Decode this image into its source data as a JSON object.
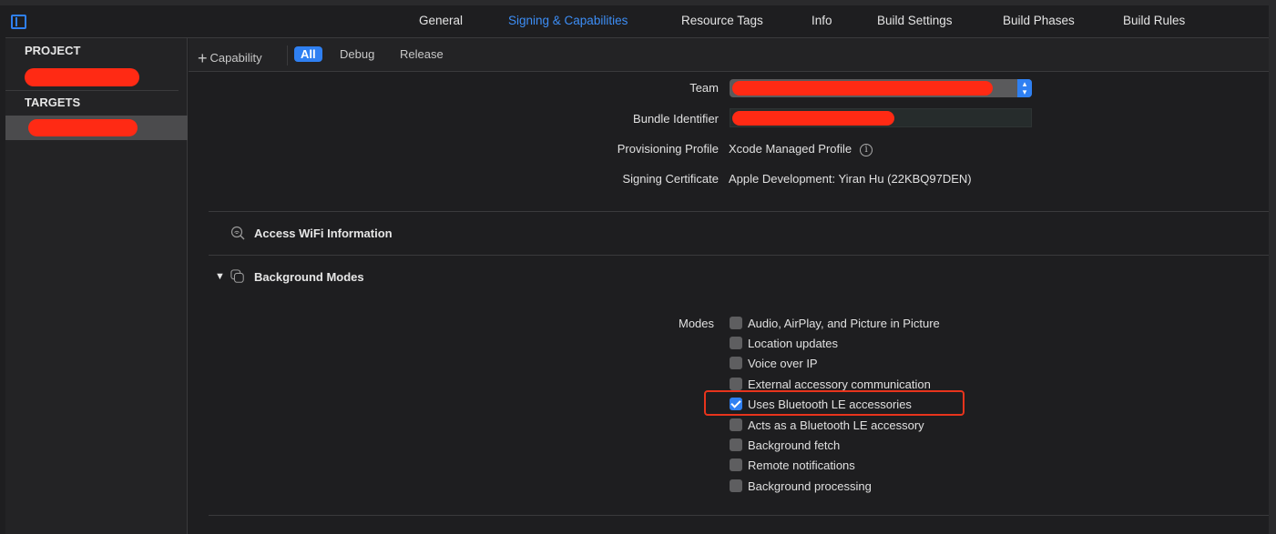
{
  "tabs": [
    {
      "label": "General",
      "active": false
    },
    {
      "label": "Signing & Capabilities",
      "active": true
    },
    {
      "label": "Resource Tags",
      "active": false
    },
    {
      "label": "Info",
      "active": false
    },
    {
      "label": "Build Settings",
      "active": false
    },
    {
      "label": "Build Phases",
      "active": false
    },
    {
      "label": "Build Rules",
      "active": false
    }
  ],
  "sidebar": {
    "project_heading": "PROJECT",
    "targets_heading": "TARGETS"
  },
  "filterbar": {
    "add_capability": "Capability",
    "filters": [
      "All",
      "Debug",
      "Release"
    ],
    "selected_filter": "All"
  },
  "signing": {
    "team_label": "Team",
    "bundle_label": "Bundle Identifier",
    "profile_label": "Provisioning Profile",
    "profile_value": "Xcode Managed Profile",
    "certificate_label": "Signing Certificate",
    "certificate_value": "Apple Development: Yiran Hu (22KBQ97DEN)"
  },
  "capabilities": {
    "wifi_title": "Access WiFi Information",
    "background_title": "Background Modes"
  },
  "background_modes": {
    "label": "Modes",
    "items": [
      {
        "label": "Audio, AirPlay, and Picture in Picture",
        "checked": false
      },
      {
        "label": "Location updates",
        "checked": false
      },
      {
        "label": "Voice over IP",
        "checked": false
      },
      {
        "label": "External accessory communication",
        "checked": false
      },
      {
        "label": "Uses Bluetooth LE accessories",
        "checked": true
      },
      {
        "label": "Acts as a Bluetooth LE accessory",
        "checked": false
      },
      {
        "label": "Background fetch",
        "checked": false
      },
      {
        "label": "Remote notifications",
        "checked": false
      },
      {
        "label": "Background processing",
        "checked": false
      }
    ]
  },
  "colors": {
    "accent": "#2f80f2",
    "highlight": "#e8341c",
    "redaction": "#ff2a14"
  }
}
